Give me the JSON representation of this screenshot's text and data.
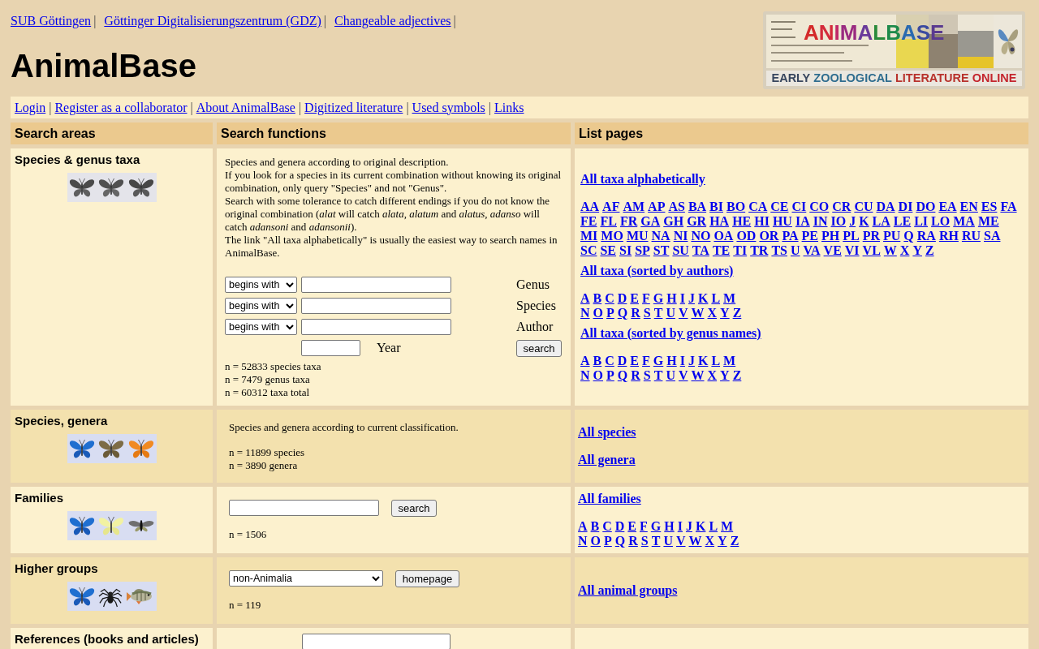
{
  "top_links": [
    {
      "label": "SUB Göttingen",
      "separator": "|"
    },
    {
      "label": "Göttinger Digitalisierungszentrum (GDZ)",
      "separator": "|"
    },
    {
      "label": "Changeable adjectives",
      "separator": "|"
    }
  ],
  "site_title": "AnimalBase",
  "logo": {
    "title": "ANIMALBASE",
    "tagline": "EARLY ZOOLOGICAL LITERATURE ONLINE"
  },
  "nav_links": [
    {
      "label": "Login",
      "separator": "|"
    },
    {
      "label": "Register as a collaborator",
      "separator": "|"
    },
    {
      "label": "About AnimalBase",
      "separator": "|"
    },
    {
      "label": "Digitized literature",
      "separator": "|"
    },
    {
      "label": "Used symbols",
      "separator": "|"
    },
    {
      "label": "Links"
    }
  ],
  "table": {
    "columns": [
      "Search areas",
      "Search functions",
      "List pages"
    ],
    "rows": [
      {
        "area": "Species & genus taxa",
        "search": {
          "kind": "taxa_search",
          "paragraphs": [
            "Species and genera according to original description.",
            "If you look for a species in its current combination without knowing its original combination, only query \"Species\" and not \"Genus\".",
            "Search with some tolerance to catch different endings if you do not know the original combination (*alat* will catch *alata*, *alatum* and *alatus*, *adanso* will catch *adansoni* and *adansonii*).",
            "The link \"All taxa alphabetically\" is usually the easiest way to search names in AnimalBase."
          ],
          "fields": [
            {
              "mode": "begins with",
              "label": "Genus"
            },
            {
              "mode": "begins with",
              "label": "Species"
            },
            {
              "mode": "begins with",
              "label": "Author"
            }
          ],
          "year_label": "Year",
          "button": "search",
          "counts": [
            "n = 52833 species taxa",
            "n = 7479 genus taxa",
            "n = 60312 taxa total"
          ]
        },
        "lists": [
          {
            "title": "All taxa alphabetically",
            "letter_rows": [
              [
                "AA",
                "AF",
                "AM",
                "AP",
                "AS",
                "BA",
                "BI",
                "BO",
                "CA",
                "CE",
                "CI",
                "CO",
                "CR",
                "CU",
                "DA",
                "DI",
                "DO",
                "EA",
                "EN",
                "ES",
                "FA"
              ],
              [
                "FE",
                "FL",
                "FR",
                "GA",
                "GH",
                "GR",
                "HA",
                "HE",
                "HI",
                "HU",
                "IA",
                "IN",
                "IO",
                "J",
                "K",
                "LA",
                "LE",
                "LI",
                "LO",
                "MA",
                "ME"
              ],
              [
                "MI",
                "MO",
                "MU",
                "NA",
                "NI",
                "NO",
                "OA",
                "OD",
                "OR",
                "PA",
                "PE",
                "PH",
                "PL",
                "PR",
                "PU",
                "Q",
                "RA",
                "RH",
                "RU",
                "SA"
              ],
              [
                "SC",
                "SE",
                "SI",
                "SP",
                "ST",
                "SU",
                "TA",
                "TE",
                "TI",
                "TR",
                "TS",
                "U",
                "VA",
                "VE",
                "VI",
                "VL",
                "W",
                "X",
                "Y",
                "Z"
              ]
            ]
          },
          {
            "title": "All taxa (sorted by authors)",
            "letter_rows": [
              [
                "A",
                "B",
                "C",
                "D",
                "E",
                "F",
                "G",
                "H",
                "I",
                "J",
                "K",
                "L",
                "M"
              ],
              [
                "N",
                "O",
                "P",
                "Q",
                "R",
                "S",
                "T",
                "U",
                "V",
                "W",
                "X",
                "Y",
                "Z"
              ]
            ]
          },
          {
            "title": "All taxa (sorted by genus names)",
            "letter_rows": [
              [
                "A",
                "B",
                "C",
                "D",
                "E",
                "F",
                "G",
                "H",
                "I",
                "J",
                "K",
                "L",
                "M"
              ],
              [
                "N",
                "O",
                "P",
                "Q",
                "R",
                "S",
                "T",
                "U",
                "V",
                "W",
                "X",
                "Y",
                "Z"
              ]
            ]
          }
        ]
      },
      {
        "area": "Species, genera",
        "search": {
          "kind": "info",
          "text": "Species and genera according to current classification.",
          "counts": [
            "n = 11899 species",
            "n = 3890 genera"
          ]
        },
        "lists": [
          {
            "title": "All species"
          },
          {
            "title": "All genera"
          }
        ]
      },
      {
        "area": "Families",
        "search": {
          "kind": "name_search",
          "button": "search",
          "counts": [
            "n = 1506"
          ]
        },
        "lists": [
          {
            "title": "All families",
            "letter_rows": [
              [
                "A",
                "B",
                "C",
                "D",
                "E",
                "F",
                "G",
                "H",
                "I",
                "J",
                "K",
                "L",
                "M"
              ],
              [
                "N",
                "O",
                "P",
                "Q",
                "R",
                "S",
                "T",
                "U",
                "V",
                "W",
                "X",
                "Y",
                "Z"
              ]
            ]
          }
        ]
      },
      {
        "area": "Higher groups",
        "search": {
          "kind": "group_select",
          "value": "non-Animalia",
          "button": "homepage",
          "counts": [
            "n = 119"
          ]
        },
        "lists": [
          {
            "title": "All animal groups"
          }
        ]
      },
      {
        "area": "References (books and articles)",
        "search": {
          "kind": "reference_search"
        },
        "lists": []
      }
    ]
  }
}
